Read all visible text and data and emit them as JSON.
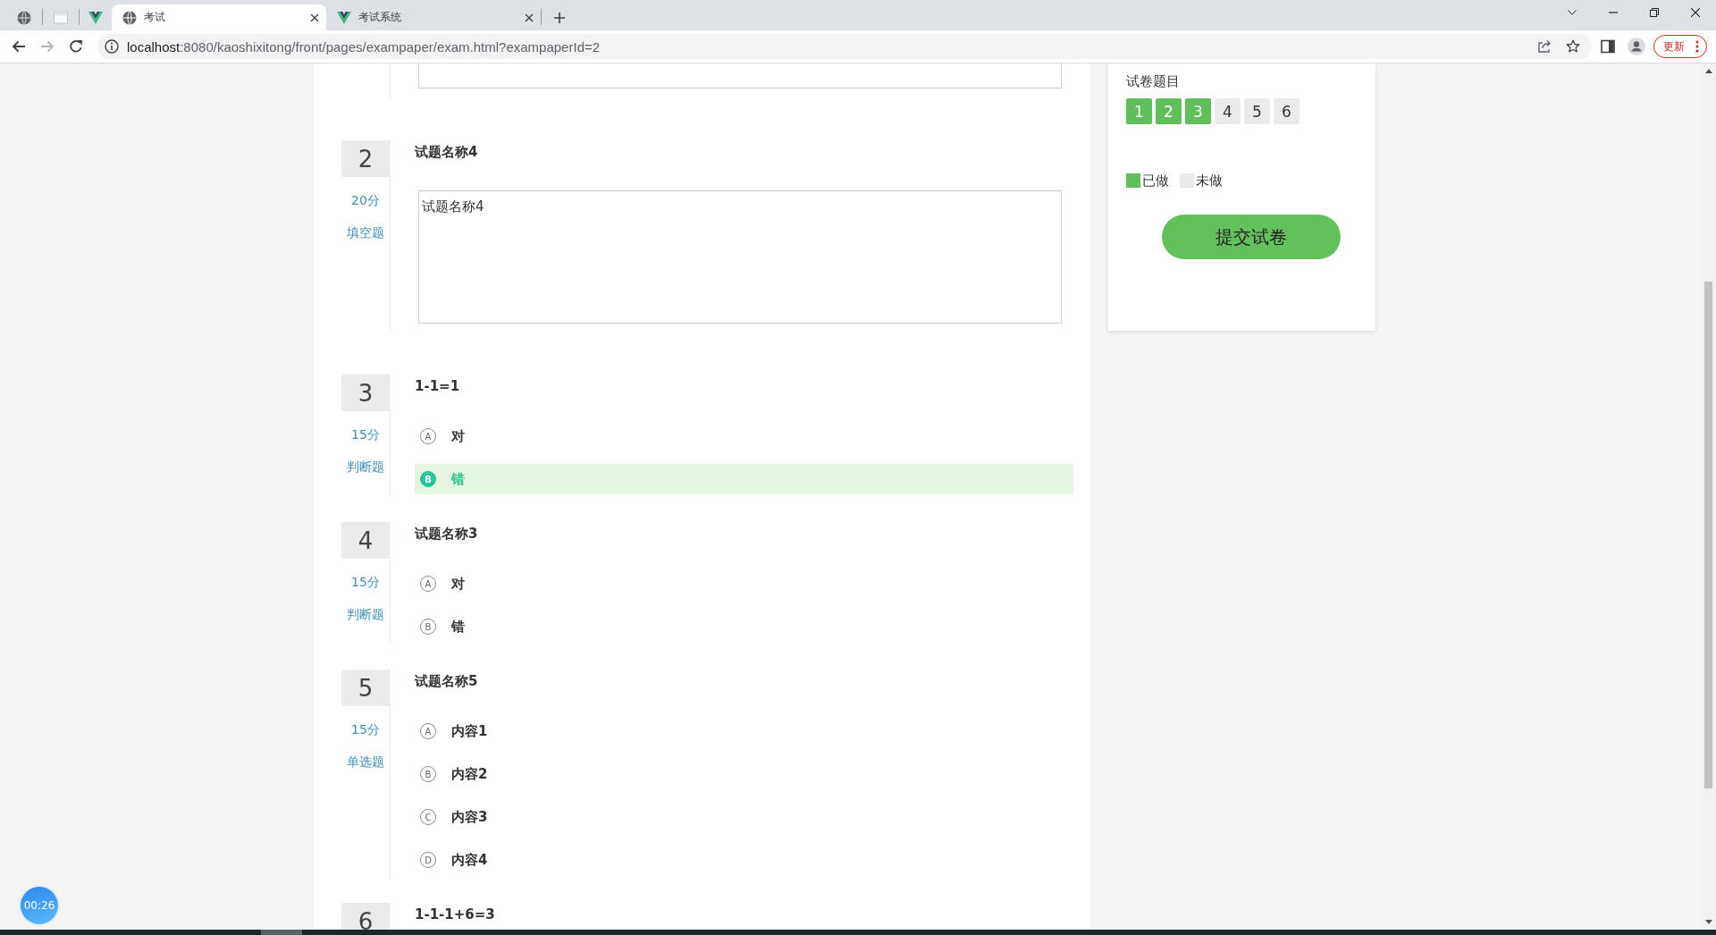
{
  "browser": {
    "tabs": [
      {
        "title": "考试",
        "selected": true
      },
      {
        "title": "考试系统",
        "selected": false
      }
    ],
    "address": {
      "host": "localhost",
      "rest": ":8080/kaoshixitong/front/pages/exampaper/exam.html?exampaperId=2"
    },
    "update_button": "更新"
  },
  "questions": [
    {
      "number": "2",
      "score": "20分",
      "type": "填空题",
      "kind": "fill",
      "title": "试题名称4",
      "answer": "试题名称4"
    },
    {
      "number": "3",
      "score": "15分",
      "type": "判断题",
      "kind": "choice",
      "title": "1-1=1",
      "options": [
        {
          "letter": "A",
          "text": "对",
          "selected": false
        },
        {
          "letter": "B",
          "text": "错",
          "selected": true
        }
      ]
    },
    {
      "number": "4",
      "score": "15分",
      "type": "判断题",
      "kind": "choice",
      "title": "试题名称3",
      "options": [
        {
          "letter": "A",
          "text": "对",
          "selected": false
        },
        {
          "letter": "B",
          "text": "错",
          "selected": false
        }
      ]
    },
    {
      "number": "5",
      "score": "15分",
      "type": "单选题",
      "kind": "choice",
      "title": "试题名称5",
      "options": [
        {
          "letter": "A",
          "text": "内容1",
          "selected": false
        },
        {
          "letter": "B",
          "text": "内容2",
          "selected": false
        },
        {
          "letter": "C",
          "text": "内容3",
          "selected": false
        },
        {
          "letter": "D",
          "text": "内容4",
          "selected": false
        }
      ]
    },
    {
      "number": "6",
      "title": "1-1-1+6=3"
    }
  ],
  "sheet": {
    "title": "试卷题目",
    "numbers": [
      {
        "label": "1",
        "done": true
      },
      {
        "label": "2",
        "done": true
      },
      {
        "label": "3",
        "done": true
      },
      {
        "label": "4",
        "done": false
      },
      {
        "label": "5",
        "done": false
      },
      {
        "label": "6",
        "done": false
      }
    ],
    "legend": [
      {
        "kind": "done",
        "label": "已做"
      },
      {
        "kind": "todo",
        "label": "未做"
      }
    ],
    "submit": "提交试卷"
  },
  "timer": "00:26"
}
